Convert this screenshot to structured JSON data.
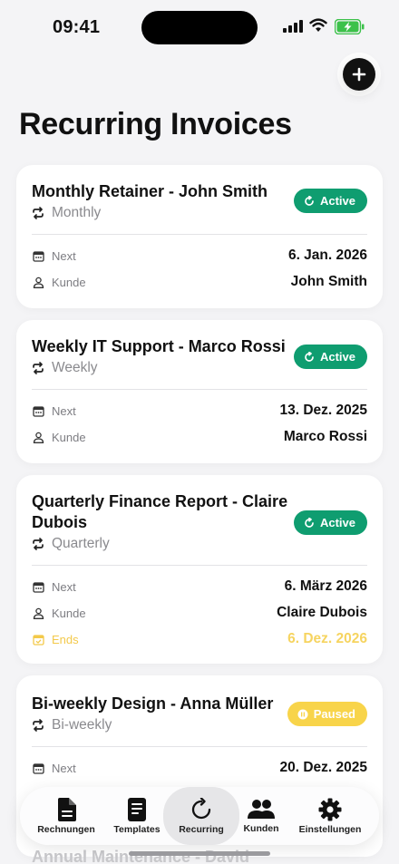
{
  "status": {
    "time": "09:41"
  },
  "page": {
    "title": "Recurring Invoices"
  },
  "invoices": [
    {
      "title": "Monthly Retainer - John Smith",
      "frequency": "Monthly",
      "status": "Active",
      "rows": [
        {
          "label": "Next",
          "value": "6. Jan. 2026"
        },
        {
          "label": "Kunde",
          "value": "John Smith"
        }
      ]
    },
    {
      "title": "Weekly IT Support - Marco Rossi",
      "frequency": "Weekly",
      "status": "Active",
      "rows": [
        {
          "label": "Next",
          "value": "13. Dez. 2025"
        },
        {
          "label": "Kunde",
          "value": "Marco Rossi"
        }
      ]
    },
    {
      "title": "Quarterly Finance Report - Claire Dubois",
      "frequency": "Quarterly",
      "status": "Active",
      "rows": [
        {
          "label": "Next",
          "value": "6. März 2026"
        },
        {
          "label": "Kunde",
          "value": "Claire Dubois"
        },
        {
          "label": "Ends",
          "value": "6. Dez. 2026"
        }
      ]
    },
    {
      "title": "Bi-weekly Design - Anna Müller",
      "frequency": "Bi-weekly",
      "status": "Paused",
      "rows": [
        {
          "label": "Next",
          "value": "20. Dez. 2025"
        }
      ]
    },
    {
      "title": "Annual Maintenance - David"
    }
  ],
  "tabbar": {
    "tabs": [
      {
        "label": "Rechnungen",
        "icon": "document-icon"
      },
      {
        "label": "Templates",
        "icon": "template-icon"
      },
      {
        "label": "Recurring",
        "icon": "recurring-icon",
        "selected": true
      },
      {
        "label": "Kunden",
        "icon": "people-icon"
      },
      {
        "label": "Einstellungen",
        "icon": "gear-icon"
      }
    ]
  },
  "colors": {
    "active": "#0f9d70",
    "paused": "#f8d44a",
    "ends": "#f6d460",
    "background": "#f4f4f6"
  }
}
